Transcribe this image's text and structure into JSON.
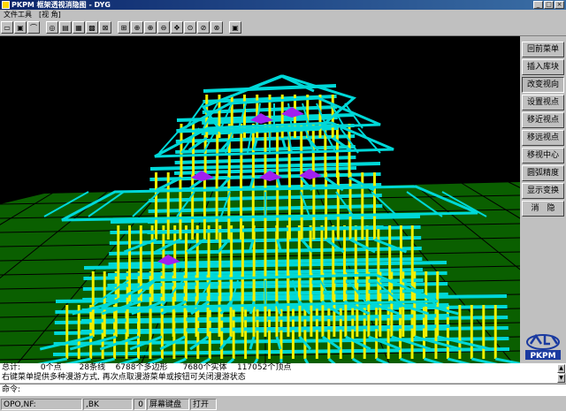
{
  "window": {
    "title": "PKPM 框架透视消隐图 - DYG"
  },
  "menu": [
    "文件工具",
    "[视 角]"
  ],
  "toolbar": {
    "icons": [
      "open-icon",
      "save-icon",
      "arc-icon",
      "circle-icon",
      "camera-icon",
      "grid-icon",
      "render-icon",
      "ruler-icon",
      "select-all-icon",
      "zoom-window-icon",
      "zoom-in-icon",
      "zoom-out-icon",
      "pan-icon",
      "zoom-extents-icon",
      "zoom-previous-icon",
      "zoom-realtime-icon",
      "cube-icon"
    ]
  },
  "side_menu": [
    {
      "label": "回前菜单",
      "active": false
    },
    {
      "label": "插入库块",
      "active": false
    },
    {
      "label": "改变视向",
      "active": true
    },
    {
      "label": "设置视点",
      "active": false
    },
    {
      "label": "移近视点",
      "active": false
    },
    {
      "label": "移远视点",
      "active": false
    },
    {
      "label": "移视中心",
      "active": false
    },
    {
      "label": "圆弧精度",
      "active": false
    },
    {
      "label": "显示变换",
      "active": false
    },
    {
      "label": "消　隐",
      "active": false
    }
  ],
  "logo": {
    "text": "PKPM"
  },
  "status": {
    "stats": "总计:        0个点       28条线    6788个多边形      7680个实体    117052个顶点",
    "hint": "右键菜单提供多种漫游方式, 再次点取漫游菜单或按钮可关闭漫游状态",
    "command_label": "命令:"
  },
  "bottom": {
    "coords": "OPO,NF:",
    "mode": ",BK",
    "value": "0",
    "screen": "屏幕键盘",
    "toggle": "打开"
  },
  "colors": {
    "background": "#000000",
    "ground": "#0a5f00",
    "beam": "#00d8d8",
    "column": "#f0f000",
    "roof": "#a020f0"
  }
}
